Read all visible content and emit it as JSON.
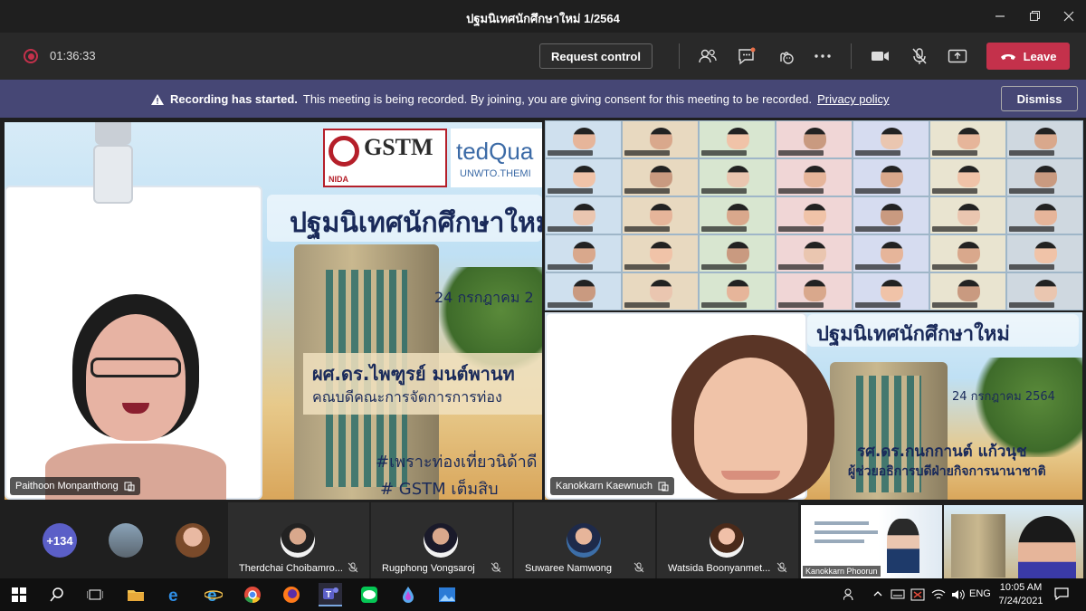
{
  "window": {
    "title": "ปฐมนิเทศนักศึกษาใหม่ 1/2564",
    "controls": [
      "minimize-icon",
      "maximize-icon",
      "close-icon"
    ]
  },
  "meeting_bar": {
    "timer": "01:36:33",
    "request_control_label": "Request control",
    "tools": [
      "people-icon",
      "chat-icon",
      "reactions-icon",
      "more-icon",
      "camera-icon",
      "mic-off-icon",
      "share-icon"
    ],
    "leave_label": "Leave"
  },
  "banner": {
    "title": "Recording has started.",
    "message": "This meeting is being recorded. By joining, you are giving consent for this meeting to be recorded.",
    "link": "Privacy policy",
    "dismiss_label": "Dismiss"
  },
  "main_stage": {
    "left_tile": {
      "participant": "Paithoon Monpanthong",
      "slide_logo": "GSTM",
      "slide_logo_sub": "NIDA",
      "slide_partner": "tedQua",
      "slide_partner_sub": "UNWTO.THEMI",
      "slide_title": "ปฐมนิเทศนักศึกษาใหม่",
      "slide_date": "24 กรกฎาคม 2",
      "slide_speaker": "ผศ.ดร.ไพฑูรย์ มนต์พานท",
      "slide_role": "คณบดีคณะการจัดการการท่อง",
      "slide_tag1": "#เพราะท่องเที่ยวนิด้าดี",
      "slide_tag2": "# GSTM เต็มสิบ"
    },
    "right_tile": {
      "participant": "Kanokkarn Kaewnuch",
      "slide_title": "ปฐมนิเทศนักศึกษาใหม่",
      "slide_date": "24 กรกฎาคม 2564",
      "slide_speaker": "รศ.ดร.กนกกานต์ แก้วนุช",
      "slide_role": "ผู้ช่วยอธิการบดีฝ่ายกิจการนานาชาติ"
    }
  },
  "bottom_strip": {
    "overflow_count": "+134",
    "participants": [
      {
        "name": "Therdchai Choibamro..."
      },
      {
        "name": "Rugphong Vongsaroj"
      },
      {
        "name": "Suwaree Namwong"
      },
      {
        "name": "Watsida Boonyanmet..."
      }
    ],
    "mini_label": "Kanokkarn Phoorun"
  },
  "taskbar": {
    "lang": "ENG",
    "time": "10:05 AM",
    "date": "7/24/2021"
  },
  "colors": {
    "accent": "#464775",
    "leave": "#c4314b",
    "background": "#1f1f1f"
  }
}
